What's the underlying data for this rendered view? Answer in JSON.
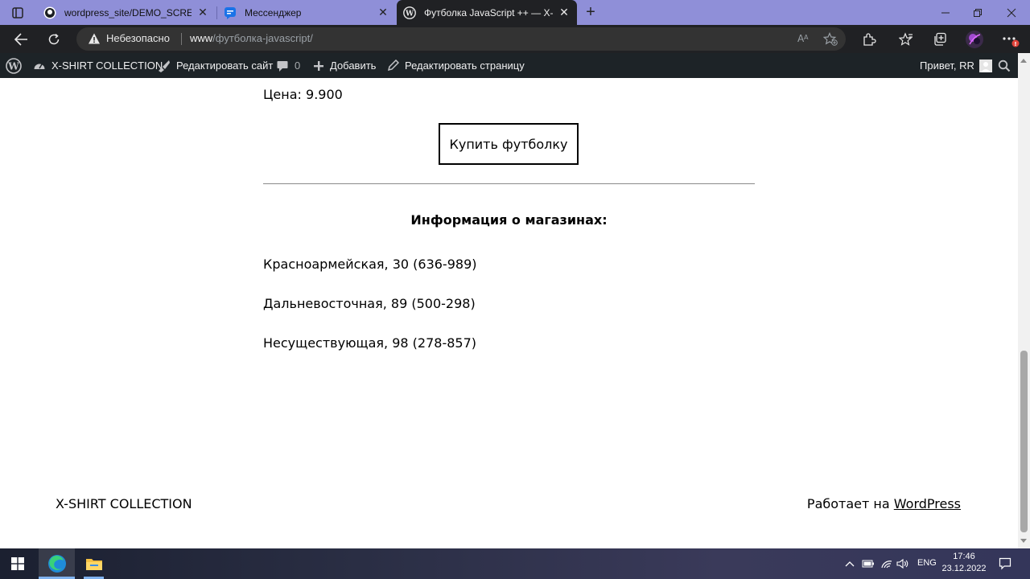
{
  "browser": {
    "tabs": [
      {
        "title": "wordpress_site/DEMO_SCREENS",
        "favicon": "github-icon",
        "active": false
      },
      {
        "title": "Мессенджер",
        "favicon": "messenger-icon",
        "active": false
      },
      {
        "title": "Футболка JavaScript ++ — X-SH",
        "favicon": "wordpress-icon",
        "active": true
      }
    ],
    "new_tab": "+",
    "address": {
      "security_label": "Небезопасно",
      "url_host": "www",
      "url_path": "/футболка-javascript/"
    }
  },
  "wp_admin_bar": {
    "site_name": "X-SHIRT COLLECTION",
    "customize_label": "Редактировать сайт",
    "comments_count": "0",
    "new_label": "Добавить",
    "edit_page_label": "Редактировать страницу",
    "greeting": "Привет, RR"
  },
  "content": {
    "price_text": "Цена: 9.900",
    "buy_button": "Купить футболку",
    "stores_heading": "Информация о магазинах:",
    "stores": [
      "Красноармейская, 30 (636-989)",
      "Дальневосточная, 89 (500-298)",
      "Несуществующая, 98 (278-857)"
    ]
  },
  "footer": {
    "site_title": "X-SHIRT COLLECTION",
    "powered_prefix": "Работает на ",
    "powered_link": "WordPress"
  },
  "taskbar": {
    "language": "ENG",
    "time": "17:46",
    "date": "23.12.2022"
  },
  "colors": {
    "tab_strip": "#8f8fd8",
    "browser_toolbar": "#202124",
    "wp_admin_bar": "#1d2327",
    "page_background": "#ffffff"
  }
}
